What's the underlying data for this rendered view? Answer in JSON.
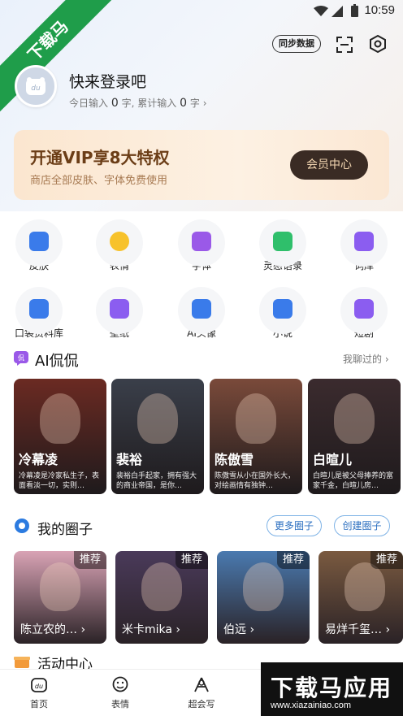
{
  "status_bar": {
    "time": "10:59"
  },
  "watermark_corner": {
    "text": "下载马"
  },
  "header": {
    "sync_label": "同步数据"
  },
  "profile": {
    "login_prompt": "快来登录吧",
    "today_label": "今日输入",
    "today_value": "0",
    "unit": "字,",
    "total_label": "累计输入",
    "total_value": "0",
    "total_unit": "字"
  },
  "vip": {
    "title": "开通VIP享8大特权",
    "subtitle": "商店全部皮肤、字体免费使用",
    "button": "会员中心"
  },
  "features": [
    {
      "label": "皮肤",
      "icon": "shirt-icon",
      "color": "#3a7bea"
    },
    {
      "label": "表情",
      "icon": "smile-icon",
      "color": "#f7c22b"
    },
    {
      "label": "字体",
      "icon": "font-icon",
      "color": "#9a59e8"
    },
    {
      "label": "灵感语录",
      "icon": "quote-icon",
      "color": "#2fbf6b"
    },
    {
      "label": "词库",
      "icon": "dictionary-icon",
      "color": "#8b5df0"
    },
    {
      "label": "口袋资料库",
      "icon": "pocket-icon",
      "color": "#3a7bea"
    },
    {
      "label": "壁纸",
      "icon": "wallpaper-icon",
      "color": "#8b5df0"
    },
    {
      "label": "AI头像",
      "icon": "ai-avatar-icon",
      "color": "#3a7bea"
    },
    {
      "label": "小说",
      "icon": "book-icon",
      "color": "#3a7bea"
    },
    {
      "label": "短剧",
      "icon": "video-icon",
      "color": "#8b5df0"
    }
  ],
  "ai_section": {
    "title": "AI侃侃",
    "more": "我聊过的",
    "cards": [
      {
        "name": "冷幕凌",
        "desc": "冷幕凌是冷家私生子，表面看淡一切，实则…",
        "bg": "#6b2a22"
      },
      {
        "name": "裴裕",
        "desc": "裴裕白手起家，拥有强大的商业帝国，是你…",
        "bg": "#3a3f4a"
      },
      {
        "name": "陈傲雪",
        "desc": "陈傲雪从小在国外长大，对绘画情有独钟…",
        "bg": "#7a4a3a"
      },
      {
        "name": "白暄儿",
        "desc": "白暄儿是被父母捧养的富家千金，白暄儿房…",
        "bg": "#3b2b2e"
      }
    ]
  },
  "circle_section": {
    "title": "我的圈子",
    "more_btn": "更多圈子",
    "create_btn": "创建圈子",
    "badge": "推荐",
    "cards": [
      {
        "name": "陈立农的…",
        "bg": "#d9a3b5"
      },
      {
        "name": "米卡mika",
        "bg": "#4a3a5a"
      },
      {
        "name": "伯远",
        "bg": "#4a7ab0"
      },
      {
        "name": "易烊千玺…",
        "bg": "#7a5a40"
      }
    ]
  },
  "activity": {
    "title": "活动中心"
  },
  "tabbar": [
    {
      "label": "首页",
      "icon": "home-icon"
    },
    {
      "label": "表情",
      "icon": "emoji-icon"
    },
    {
      "label": "超会写",
      "icon": "write-icon"
    }
  ],
  "watermark": {
    "title": "下载马应用",
    "url": "www.xiazainiao.com"
  }
}
